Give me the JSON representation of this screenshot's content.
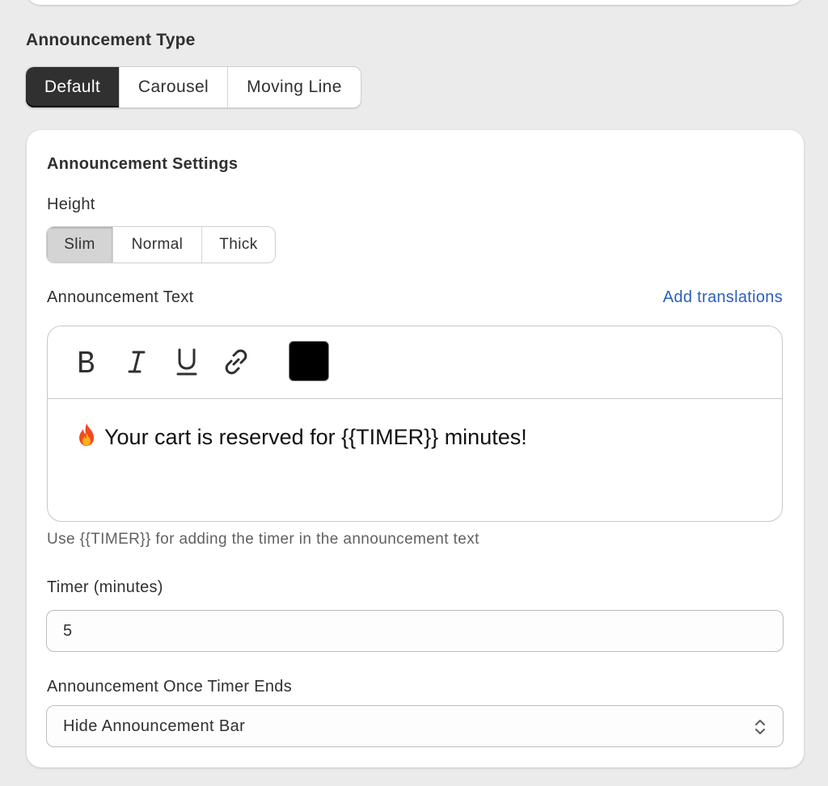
{
  "announcement_type": {
    "title": "Announcement Type",
    "options": [
      "Default",
      "Carousel",
      "Moving Line"
    ],
    "selected": "Default"
  },
  "settings": {
    "title": "Announcement Settings",
    "height": {
      "label": "Height",
      "options": [
        "Slim",
        "Normal",
        "Thick"
      ],
      "selected": "Slim"
    },
    "announcement_text": {
      "label": "Announcement Text",
      "add_translations": "Add translations",
      "toolbar": {
        "bold": "B",
        "italic": "I",
        "underline": "U",
        "link_icon": "link-icon",
        "text_color": "#000000"
      },
      "emoji": "🔥",
      "content": "Your cart is reserved for {{TIMER}} minutes!",
      "help_text": "Use {{TIMER}} for adding the timer in the announcement text"
    },
    "timer": {
      "label": "Timer (minutes)",
      "value": "5"
    },
    "timer_end": {
      "label": "Announcement Once Timer Ends",
      "selected": "Hide Announcement Bar",
      "chevron_icon": "select-chevron-icon"
    }
  }
}
